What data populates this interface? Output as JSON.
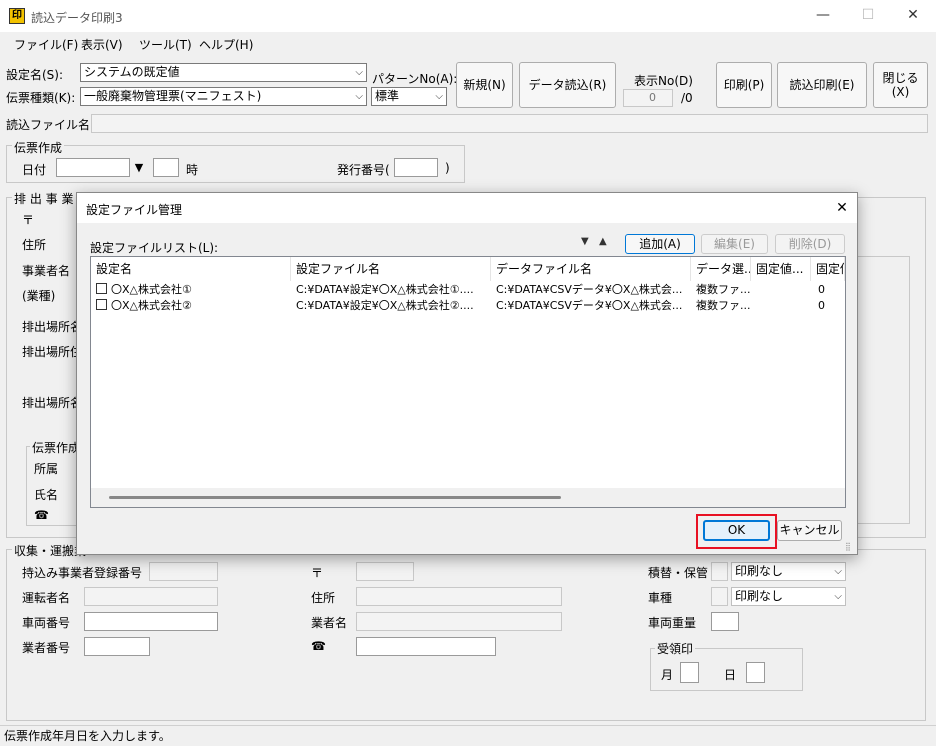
{
  "window": {
    "title": "読込データ印刷3",
    "minimize": "—",
    "maximize": "☐",
    "close": "✕",
    "app_icon": "印"
  },
  "menu": [
    "ファイル(F)",
    "表示(V)",
    "ツール(T)",
    "ヘルプ(H)"
  ],
  "top": {
    "setting_label": "設定名(S):",
    "setting_value": "システムの既定値",
    "slip_label": "伝票種類(K):",
    "slip_value": "一般廃棄物管理票(マニフェスト)",
    "pattern_label": "パターンNo(A):",
    "pattern_value": "標準",
    "new_button": "新規(N)",
    "read_button": "データ読込(R)",
    "display_label": "表示No(D)",
    "display_value": "0",
    "display_total": "/0",
    "print_button": "印刷(P)",
    "readprint_button": "読込印刷(E)",
    "close_button": "閉じる(X)",
    "readfile_label": "読込ファイル名"
  },
  "slip": {
    "group": "伝票作成",
    "date_label": "日付",
    "hour_label": "時",
    "issue_label": "発行番号(",
    "issue_close": ")"
  },
  "emitter": {
    "group": "排 出 事 業 者",
    "postal": "〒",
    "address": "住所",
    "company": "事業者名",
    "type": "(業種)",
    "site1": "排出場所名",
    "site2": "排出場所住",
    "site3": "排出場所名",
    "sub_group": "伝票作成",
    "dept": "所属",
    "name": "氏名",
    "tel": "☎"
  },
  "collect": {
    "group": "収集・運搬業",
    "reg_no": "持込み事業者登録番号",
    "driver": "運転者名",
    "vehicle_no": "車両番号",
    "operator_no": "業者番号",
    "postal": "〒",
    "address": "住所",
    "company": "業者名",
    "tel": "☎",
    "storage": "積替・保管",
    "storage_value": "印刷なし",
    "vehicle_type": "車種",
    "vehicle_type_value": "印刷なし",
    "weight": "車両重量",
    "receipt": "受領印",
    "month": "月",
    "day": "日"
  },
  "dialog": {
    "title": "設定ファイル管理",
    "close": "✕",
    "list_label": "設定ファイルリスト(L):",
    "down_arrow": "▼",
    "up_arrow": "▲",
    "add_button": "追加(A)",
    "edit_button": "編集(E)",
    "delete_button": "削除(D)",
    "columns": [
      "設定名",
      "設定ファイル名",
      "データファイル名",
      "データ選...",
      "固定値...",
      "固定値"
    ],
    "rows": [
      {
        "name": "〇X△株式会社①",
        "file": "C:¥DATA¥設定¥〇X△株式会社①....",
        "data": "C:¥DATA¥CSVデータ¥〇X△株式会...",
        "select": "複数ファ...",
        "fixed1": "",
        "fixed2": "0"
      },
      {
        "name": "〇X△株式会社②",
        "file": "C:¥DATA¥設定¥〇X△株式会社②....",
        "data": "C:¥DATA¥CSVデータ¥〇X△株式会...",
        "select": "複数ファ...",
        "fixed1": "",
        "fixed2": "0"
      }
    ],
    "ok_button": "OK",
    "cancel_button": "キャンセル"
  },
  "status": "伝票作成年月日を入力します。",
  "colors": {
    "accent": "#e81123",
    "focus": "#0078d7"
  }
}
